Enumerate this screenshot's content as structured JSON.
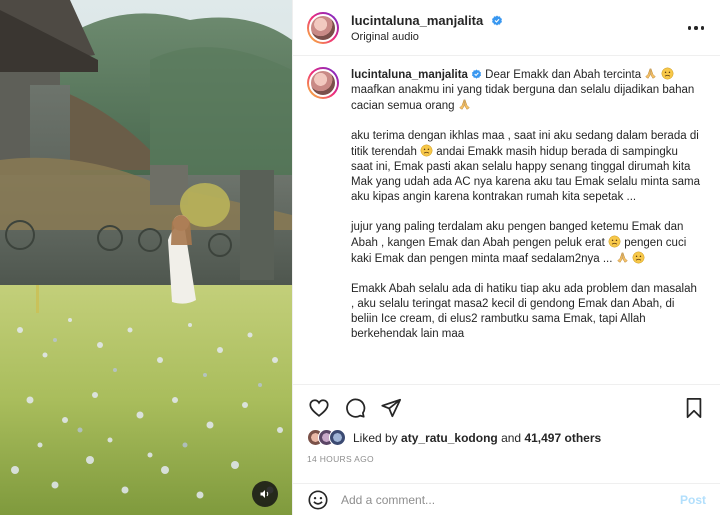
{
  "header": {
    "username": "lucintaluna_manjalita",
    "subtitle": "Original audio"
  },
  "caption": {
    "username": "lucintaluna_manjalita",
    "paragraphs": [
      [
        "Dear Emakk dan Abah tercinta ",
        {
          "emoji": "pray"
        },
        " ",
        {
          "emoji": "sad"
        },
        " maafkan anakmu ini yang tidak berguna dan selalu dijadikan bahan cacian semua orang ",
        {
          "emoji": "pray"
        }
      ],
      [
        "aku terima dengan ikhlas maa , saat ini aku sedang dalam berada di titik terendah ",
        {
          "emoji": "sad"
        },
        " andai Emakk masih hidup berada di sampingku saat ini, Emak pasti akan selalu happy senang tinggal dirumah kita Mak yang udah ada AC nya karena aku tau Emak selalu minta sama aku kipas angin karena kontrakan rumah kita sepetak ..."
      ],
      [
        "jujur yang paling terdalam aku pengen banged ketemu Emak dan Abah , kangen Emak dan Abah pengen peluk erat ",
        {
          "emoji": "sad"
        },
        " pengen cuci kaki Emak dan pengen minta maaf sedalam2nya ... ",
        {
          "emoji": "pray"
        },
        " ",
        {
          "emoji": "sad"
        }
      ],
      [
        "Emakk Abah selalu ada di hatiku tiap aku ada problem dan masalah , aku selalu teringat masa2 kecil di gendong Emak dan Abah, di beliin Ice cream, di elus2 rambutku sama Emak, tapi Allah berkehendak lain maa"
      ]
    ]
  },
  "likes": {
    "prefix": "Liked by",
    "user": "aty_ratu_kodong",
    "middle": "and",
    "count": "41,497 others"
  },
  "timestamp": "14 HOURS AGO",
  "comment": {
    "placeholder": "Add a comment...",
    "post_label": "Post"
  },
  "icons": {
    "verified": "verified-badge-icon",
    "more": "more-options-icon",
    "like": "heart-icon",
    "comment": "comment-bubble-icon",
    "share": "paper-plane-icon",
    "save": "bookmark-icon",
    "emoji": "smiley-icon",
    "audio": "speaker-icon"
  },
  "colors": {
    "verified": "#3897f0",
    "post_disabled": "#b2dffc",
    "muted": "#8e8e8e"
  }
}
